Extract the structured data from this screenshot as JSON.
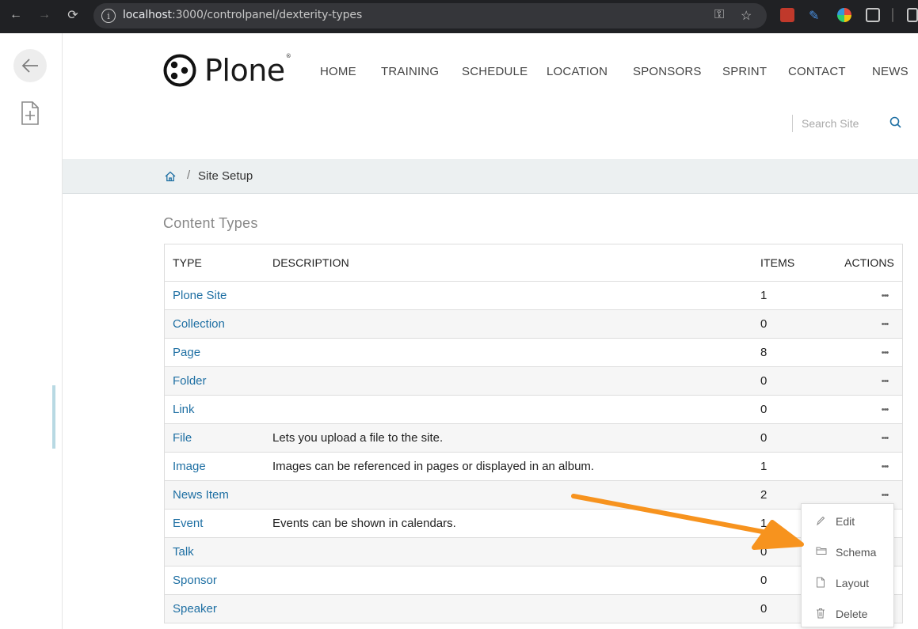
{
  "browser": {
    "url_host": "localhost",
    "url_path": ":3000/controlpanel/dexterity-types"
  },
  "logo": {
    "name": "Plone",
    "mark": "®"
  },
  "nav": [
    {
      "label": "HOME"
    },
    {
      "label": "TRAINING"
    },
    {
      "label": "SCHEDULE"
    },
    {
      "label": "LOCATION"
    },
    {
      "label": "SPONSORS"
    },
    {
      "label": "SPRINT"
    },
    {
      "label": "CONTACT"
    },
    {
      "label": "NEWS"
    }
  ],
  "search": {
    "placeholder": "Search Site"
  },
  "breadcrumb": {
    "separator": "/",
    "current": "Site Setup"
  },
  "page": {
    "title": "Content Types"
  },
  "table": {
    "headers": {
      "type": "TYPE",
      "description": "DESCRIPTION",
      "items": "ITEMS",
      "actions": "ACTIONS"
    },
    "actions_glyph": "•••",
    "rows": [
      {
        "type": "Plone Site",
        "description": "",
        "items": "1"
      },
      {
        "type": "Collection",
        "description": "",
        "items": "0"
      },
      {
        "type": "Page",
        "description": "",
        "items": "8"
      },
      {
        "type": "Folder",
        "description": "",
        "items": "0"
      },
      {
        "type": "Link",
        "description": "",
        "items": "0"
      },
      {
        "type": "File",
        "description": "Lets you upload a file to the site.",
        "items": "0"
      },
      {
        "type": "Image",
        "description": "Images can be referenced in pages or displayed in an album.",
        "items": "1"
      },
      {
        "type": "News Item",
        "description": "",
        "items": "2"
      },
      {
        "type": "Event",
        "description": "Events can be shown in calendars.",
        "items": "1"
      },
      {
        "type": "Talk",
        "description": "",
        "items": "0"
      },
      {
        "type": "Sponsor",
        "description": "",
        "items": "0"
      },
      {
        "type": "Speaker",
        "description": "",
        "items": "0"
      }
    ]
  },
  "context_menu": {
    "items": [
      {
        "label": "Edit",
        "icon": "pencil-icon"
      },
      {
        "label": "Schema",
        "icon": "folder-icon"
      },
      {
        "label": "Layout",
        "icon": "file-icon"
      },
      {
        "label": "Delete",
        "icon": "trash-icon"
      }
    ]
  },
  "colors": {
    "link": "#1e6fa3",
    "annotation_arrow": "#f7931e",
    "breadcrumb_bg": "#ecf0f1"
  }
}
